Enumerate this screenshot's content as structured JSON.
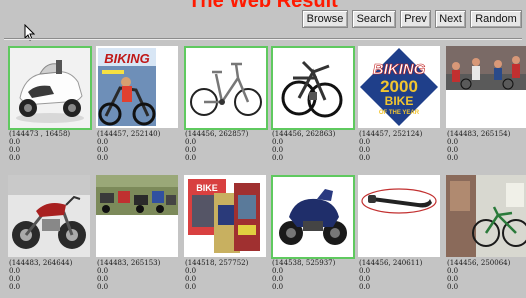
{
  "page": {
    "title": "The Web Result"
  },
  "toolbar": {
    "browse": "Browse",
    "search": "Search",
    "prev": "Prev",
    "next": "Next",
    "random": "Random"
  },
  "results": [
    {
      "id": "(144473 , 16458)",
      "v1": "0.0",
      "v2": "0.0",
      "v3": "0.0",
      "image": "white scooter"
    },
    {
      "id": "(144457, 252140)",
      "v1": "0.0",
      "v2": "0.0",
      "v3": "0.0",
      "image": "Biking magazine cover",
      "cover_text": "BIKING"
    },
    {
      "id": "(144456, 262857)",
      "v1": "0.0",
      "v2": "0.0",
      "v3": "0.0",
      "image": "folding bicycle"
    },
    {
      "id": "(144456, 262863)",
      "v1": "0.0",
      "v2": "0.0",
      "v3": "0.0",
      "image": "folded bicycle"
    },
    {
      "id": "(144457, 252124)",
      "v1": "0.0",
      "v2": "0.0",
      "v3": "0.0",
      "image": "bike of the year badge",
      "badge_top": "BIKING",
      "badge_year": "2000",
      "badge_line1": "BIKE",
      "badge_line2": "OF THE YEAR"
    },
    {
      "id": "(144483, 265154)",
      "v1": "0.0",
      "v2": "0.0",
      "v3": "0.0",
      "image": "crowd of bikes"
    },
    {
      "id": "(144483, 264644)",
      "v1": "0.0",
      "v2": "0.0",
      "v3": "0.0",
      "image": "red motorcycle"
    },
    {
      "id": "(144483, 265153)",
      "v1": "0.0",
      "v2": "0.0",
      "v3": "0.0",
      "image": "motorcycle rally"
    },
    {
      "id": "(144518, 257752)",
      "v1": "0.0",
      "v2": "0.0",
      "v3": "0.0",
      "image": "magazine stack",
      "cover_text": "BIKE"
    },
    {
      "id": "(144538, 525937)",
      "v1": "0.0",
      "v2": "0.0",
      "v3": "0.0",
      "image": "blue motorcycle"
    },
    {
      "id": "(144456, 240611)",
      "v1": "0.0",
      "v2": "0.0",
      "v3": "0.0",
      "image": "bike tool"
    },
    {
      "id": "(144456, 250064)",
      "v1": "0.0",
      "v2": "0.0",
      "v3": "0.0",
      "image": "bicycle workshop"
    }
  ]
}
